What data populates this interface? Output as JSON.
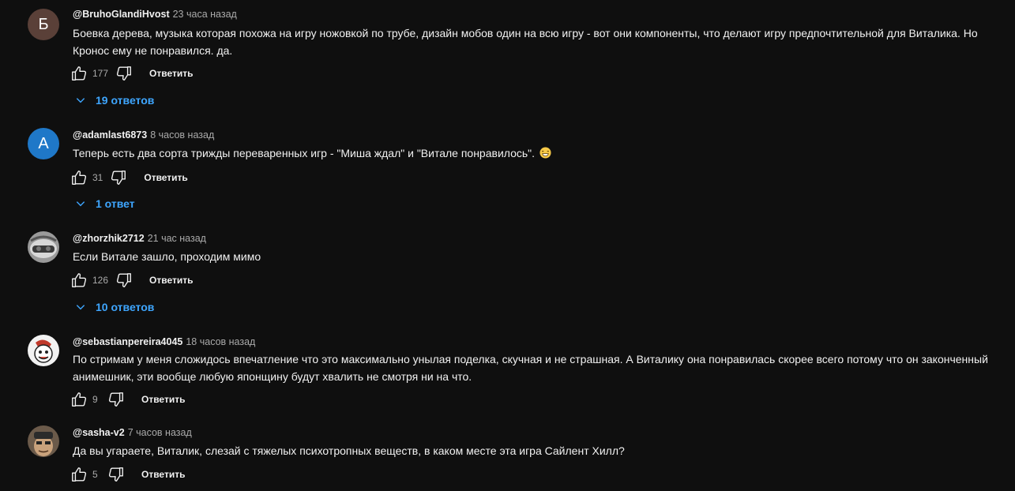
{
  "comments": [
    {
      "avatar_letter": "Б",
      "author": "@BruhoGlandiHvost",
      "time": "23 часа назад",
      "text": "Боевка дерева, музыка которая похожа на игру ножовкой по трубе, дизайн мобов один на всю игру - вот они компоненты, что делают игру предпочтительной для Виталика. Но Кронос ему не понравился. да.",
      "likes": "177",
      "reply_label": "Ответить",
      "replies": "19 ответов"
    },
    {
      "avatar_letter": "A",
      "author": "@adamlast6873",
      "time": "8 часов назад",
      "text": "Теперь есть два сорта трижды переваренных  игр - \"Миша ждал\" и \"Витале понравилось\".",
      "emoji_icon": "grinning-face-icon",
      "likes": "31",
      "reply_label": "Ответить",
      "replies": "1 ответ"
    },
    {
      "author": "@zhorzhik2712",
      "time": "21 час назад",
      "text": "Если Витале зашло, проходим мимо",
      "likes": "126",
      "reply_label": "Ответить",
      "replies": "10 ответов"
    },
    {
      "author": "@sebastianpereira4045",
      "time": "18 часов назад",
      "text": "По стримам у меня сложидось впечатление что это максимально унылая поделка, скучная и не страшная. А Виталику она понравилась скорее всего потому что он законченный анимешник, эти вообще любую японщину будут хвалить не смотря ни на что.",
      "likes": "9",
      "reply_label": "Ответить"
    },
    {
      "author": "@sasha-v2",
      "time": "7 часов назад",
      "text": "Да вы угараете, Виталик, слезай с тяжелых психотропных веществ, в каком месте эта игра Сайлент Хилл?",
      "likes": "5",
      "reply_label": "Ответить"
    }
  ],
  "colors": {
    "background": "#0f0f0f",
    "link_blue": "#3ea6ff",
    "secondary_text": "#aaaaaa"
  }
}
